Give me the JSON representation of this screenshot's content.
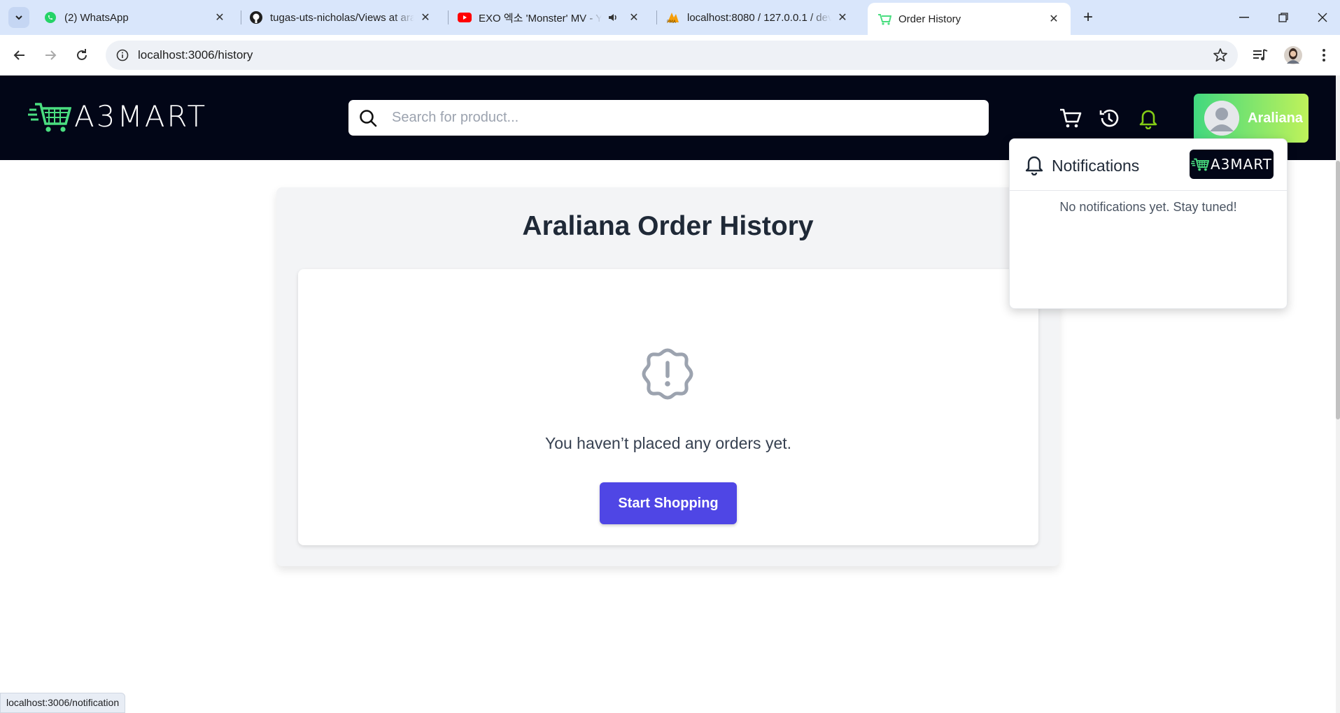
{
  "browser": {
    "tabs": [
      {
        "title": "(2) WhatsApp",
        "icon": "whatsapp-icon"
      },
      {
        "title": "tugas-uts-nicholas/Views at ara",
        "icon": "github-icon"
      },
      {
        "title": "EXO 엑소 'Monster' MV - Yo",
        "icon": "youtube-icon"
      },
      {
        "title": "localhost:8080 / 127.0.0.1 / dev",
        "icon": "phpmyadmin-icon"
      },
      {
        "title": "Order History",
        "icon": "cart-favicon-icon"
      }
    ],
    "url": "localhost:3006/history",
    "status_url": "localhost:3006/notification"
  },
  "header": {
    "logo_text": "A3MART",
    "search_placeholder": "Search for product...",
    "user_name": "Araliana"
  },
  "main": {
    "title": "Araliana Order History",
    "empty_message": "You haven’t placed any orders yet.",
    "cta_label": "Start Shopping"
  },
  "notifications": {
    "title": "Notifications",
    "logo_text": "A3MART",
    "empty_message": "No notifications yet. Stay tuned!"
  },
  "colors": {
    "header_bg": "#020617",
    "accent_green": "#84cc16",
    "cta": "#4f46e5",
    "user_gradient_start": "#41d87f",
    "user_gradient_end": "#bff25a"
  }
}
